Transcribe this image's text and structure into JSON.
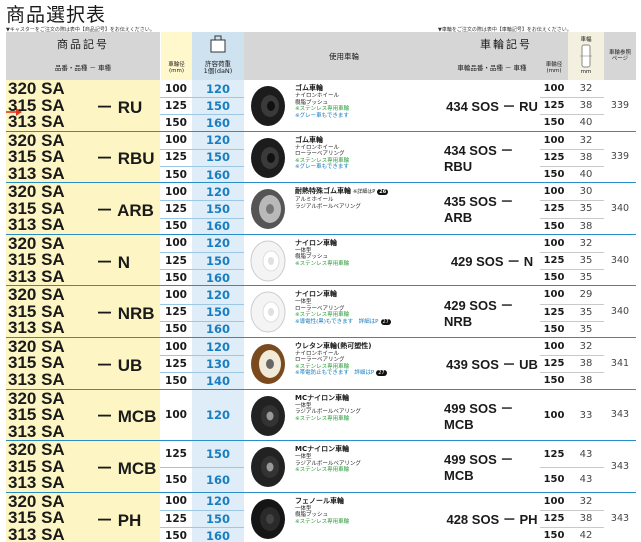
{
  "title": "商品選択表",
  "note_left": "▼キャスターをご注文の際は表中【商品記号】をお伝えください。",
  "note_right": "▼車輪をご注文の際は表中【車輪記号】をお伝えください。",
  "header": {
    "product_code": "商品記号",
    "product_sub": "品番・品種 － 車種",
    "wheel_dia": "車輪径",
    "mm": "(mm)",
    "load": "許容荷重",
    "load_unit": "1個(daN)",
    "wheel_used": "使用車輪",
    "wheel_code": "車輪記号",
    "wheel_sub": "車輪品番・品種 － 車種",
    "wheel_dia2": "車輪径",
    "mm2": "(mm)",
    "width_label": "車幅",
    "width_mm": "mm",
    "ref_page": "車輪参照ページ"
  },
  "rows": [
    {
      "suffix": "－ RU",
      "models": [
        "320 SA",
        "315 SA",
        "313 SA"
      ],
      "dia": [
        "100",
        "125",
        "150"
      ],
      "load": [
        "120",
        "150",
        "160"
      ],
      "wheel_type": "rubber",
      "desc": {
        "name": "ゴム車輪",
        "lines": [
          {
            "t": "ナイロンホイール",
            "c": ""
          },
          {
            "t": "樹脂ブッシュ",
            "c": ""
          },
          {
            "t": "※ステンレス専用車輪",
            "c": "g"
          },
          {
            "t": "※グレー車もできます",
            "c": "b"
          }
        ]
      },
      "wheel_code": "434 SOS － RU",
      "rdia": [
        "100",
        "125",
        "150"
      ],
      "width": [
        "32",
        "38",
        "40"
      ],
      "page": "339",
      "arrow": true
    },
    {
      "suffix": "－ RBU",
      "models": [
        "320 SA",
        "315 SA",
        "313 SA"
      ],
      "dia": [
        "100",
        "125",
        "150"
      ],
      "load": [
        "120",
        "150",
        "160"
      ],
      "wheel_type": "rubber",
      "desc": {
        "name": "ゴム車輪",
        "lines": [
          {
            "t": "ナイロンホイール",
            "c": ""
          },
          {
            "t": "ローラーベアリング",
            "c": ""
          },
          {
            "t": "※ステンレス専用車輪",
            "c": "g"
          },
          {
            "t": "※グレー車もできます",
            "c": "b"
          }
        ]
      },
      "wheel_code": "434 SOS － RBU",
      "rdia": [
        "100",
        "125",
        "150"
      ],
      "width": [
        "32",
        "38",
        "40"
      ],
      "page": "339"
    },
    {
      "suffix": "－ ARB",
      "models": [
        "320 SA",
        "315 SA",
        "313 SA"
      ],
      "dia": [
        "100",
        "125",
        "150"
      ],
      "load": [
        "120",
        "150",
        "160"
      ],
      "wheel_type": "gray",
      "desc": {
        "name": "耐熱特殊ゴム車輪",
        "name_note": "※詳細はP",
        "badge": "26",
        "lines": [
          {
            "t": "アルミホイール",
            "c": ""
          },
          {
            "t": "ラジアルボールベアリング",
            "c": ""
          }
        ]
      },
      "wheel_code": "435 SOS － ARB",
      "rdia": [
        "100",
        "125",
        "150"
      ],
      "width": [
        "30",
        "35",
        "38"
      ],
      "page": "340"
    },
    {
      "suffix": "－ N",
      "models": [
        "320 SA",
        "315 SA",
        "313 SA"
      ],
      "dia": [
        "100",
        "125",
        "150"
      ],
      "load": [
        "120",
        "150",
        "160"
      ],
      "wheel_type": "white",
      "desc": {
        "name": "ナイロン車輪",
        "lines": [
          {
            "t": "一体型",
            "c": ""
          },
          {
            "t": "樹脂ブッシュ",
            "c": ""
          },
          {
            "t": "※ステンレス専用車輪",
            "c": "g"
          }
        ]
      },
      "wheel_code": "429 SOS － N",
      "rdia": [
        "100",
        "125",
        "150"
      ],
      "width": [
        "32",
        "35",
        "35"
      ],
      "page": "340"
    },
    {
      "suffix": "－ NRB",
      "models": [
        "320 SA",
        "315 SA",
        "313 SA"
      ],
      "dia": [
        "100",
        "125",
        "150"
      ],
      "load": [
        "120",
        "150",
        "160"
      ],
      "wheel_type": "white",
      "desc": {
        "name": "ナイロン車輪",
        "lines": [
          {
            "t": "一体型",
            "c": ""
          },
          {
            "t": "ローラーベアリング",
            "c": ""
          },
          {
            "t": "※ステンレス専用車輪",
            "c": "g"
          },
          {
            "t": "※導電性(黒)もできます　詳細はP",
            "c": "b",
            "badge": "27"
          }
        ]
      },
      "wheel_code": "429 SOS － NRB",
      "rdia": [
        "100",
        "125",
        "150"
      ],
      "width": [
        "29",
        "35",
        "35"
      ],
      "page": "340"
    },
    {
      "suffix": "－ UB",
      "models": [
        "320 SA",
        "315 SA",
        "313 SA"
      ],
      "dia": [
        "100",
        "125",
        "150"
      ],
      "load": [
        "120",
        "130",
        "140"
      ],
      "wheel_type": "urethane",
      "desc": {
        "name": "ウレタン車輪(熱可塑性)",
        "lines": [
          {
            "t": "ナイロンホイール",
            "c": ""
          },
          {
            "t": "ローラーベアリング",
            "c": ""
          },
          {
            "t": "※ステンレス専用車輪",
            "c": "g"
          },
          {
            "t": "※帯電防止もできます　詳細はP",
            "c": "b",
            "badge": "27"
          }
        ]
      },
      "wheel_code": "439 SOS － UB",
      "rdia": [
        "100",
        "125",
        "150"
      ],
      "width": [
        "32",
        "38",
        "38"
      ],
      "page": "341"
    },
    {
      "suffix": "－ MCB",
      "models": [
        "320 SA",
        "315 SA",
        "313 SA"
      ],
      "dia": [
        "100"
      ],
      "load": [
        "120"
      ],
      "single": true,
      "wheel_type": "mc",
      "desc": {
        "name": "MCナイロン車輪",
        "lines": [
          {
            "t": "一体型",
            "c": ""
          },
          {
            "t": "ラジアルボールベアリング",
            "c": ""
          },
          {
            "t": "※ステンレス専用車輪",
            "c": "g"
          }
        ]
      },
      "wheel_code": "499 SOS － MCB",
      "rdia": [
        "100"
      ],
      "width": [
        "33"
      ],
      "page": "343",
      "rsingle": true
    },
    {
      "suffix": "－ MCB",
      "models": [
        "320 SA",
        "315 SA",
        "313 SA"
      ],
      "dia": [
        "125",
        "150"
      ],
      "load": [
        "150",
        "160"
      ],
      "double": true,
      "wheel_type": "mc",
      "desc": {
        "name": "MCナイロン車輪",
        "lines": [
          {
            "t": "一体型",
            "c": ""
          },
          {
            "t": "ラジアルボールベアリング",
            "c": ""
          },
          {
            "t": "※ステンレス専用車輪",
            "c": "g"
          }
        ]
      },
      "wheel_code": "499 SOS － MCB",
      "rdia": [
        "125",
        "150"
      ],
      "width": [
        "43",
        "43"
      ],
      "page": "343",
      "rdouble": true
    },
    {
      "suffix": "－ PH",
      "models": [
        "320 SA",
        "315 SA",
        "313 SA"
      ],
      "dia": [
        "100",
        "125",
        "150"
      ],
      "load": [
        "120",
        "150",
        "160"
      ],
      "wheel_type": "phenol",
      "desc": {
        "name": "フェノール車輪",
        "lines": [
          {
            "t": "一体型",
            "c": ""
          },
          {
            "t": "樹脂ブッシュ",
            "c": ""
          },
          {
            "t": "※ステンレス専用車輪",
            "c": "g"
          }
        ]
      },
      "wheel_code": "428 SOS － PH",
      "rdia": [
        "100",
        "125",
        "150"
      ],
      "width": [
        "32",
        "38",
        "42"
      ],
      "page": "343"
    }
  ],
  "colors": {
    "accent": "#1a7dbf",
    "green": "#2a9b3a",
    "arrow": "#e8321e",
    "yellow": "#fdf6c4",
    "blue": "#deedf7"
  }
}
